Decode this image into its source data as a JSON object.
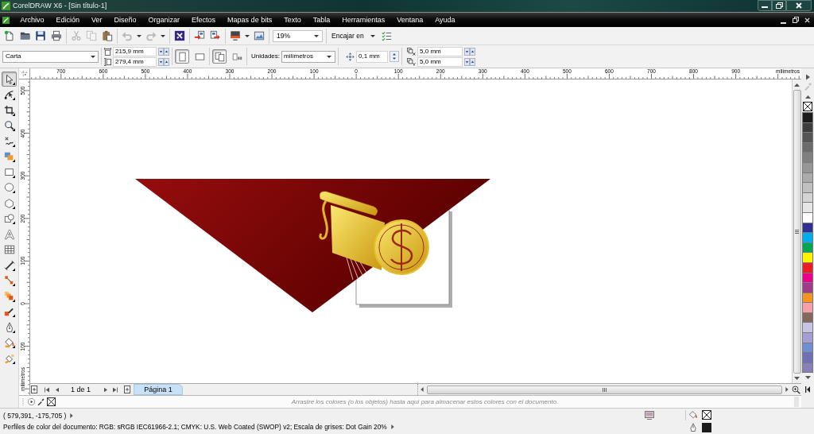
{
  "title_bar": {
    "title": "CorelDRAW X6 - [Sin título-1]"
  },
  "menu_bar": {
    "items": [
      "Archivo",
      "Edición",
      "Ver",
      "Diseño",
      "Organizar",
      "Efectos",
      "Mapas de bits",
      "Texto",
      "Tabla",
      "Herramientas",
      "Ventana",
      "Ayuda"
    ]
  },
  "standard_toolbar": {
    "groups": [
      [
        {
          "kind": "new",
          "disabled": false
        },
        {
          "kind": "open",
          "disabled": false
        },
        {
          "kind": "save",
          "disabled": false
        },
        {
          "kind": "print",
          "disabled": false
        }
      ],
      [
        {
          "kind": "cut",
          "disabled": true
        },
        {
          "kind": "copy",
          "disabled": true
        },
        {
          "kind": "paste",
          "disabled": false
        }
      ],
      [
        {
          "kind": "undo",
          "disabled": true,
          "dropdown": true
        },
        {
          "kind": "redo",
          "disabled": true,
          "dropdown": true
        }
      ],
      [
        {
          "kind": "connect",
          "disabled": false
        }
      ],
      [
        {
          "kind": "import",
          "disabled": false
        },
        {
          "kind": "export",
          "disabled": false
        }
      ],
      [
        {
          "kind": "launcher",
          "disabled": false,
          "dropdown": true
        },
        {
          "kind": "welcome",
          "disabled": false
        }
      ]
    ],
    "zoom": "19%",
    "snap": "Encajar en"
  },
  "property_bar": {
    "paper_size": "Carta",
    "page_width": "215,9 mm",
    "page_height": "279,4 mm",
    "orientation": [
      {
        "kind": "portrait",
        "selected": true
      },
      {
        "kind": "landscape",
        "selected": false
      }
    ],
    "page_scope": [
      {
        "kind": "all_pages",
        "selected": true
      },
      {
        "kind": "current_page",
        "selected": false
      }
    ],
    "units_label": "Unidades:",
    "units": "milímetros",
    "nudge": "0,1 mm",
    "duplicate_x": "5,0 mm",
    "duplicate_y": "5,0 mm"
  },
  "toolbox": {
    "tools": [
      {
        "kind": "pick",
        "selected": true
      },
      {
        "kind": "shape",
        "selected": false
      },
      {
        "kind": "crop",
        "selected": false
      },
      {
        "kind": "zoom",
        "selected": false
      },
      {
        "kind": "freehand",
        "selected": false
      },
      {
        "kind": "smart_fill",
        "selected": false
      },
      {
        "kind": "rectangle",
        "selected": false
      },
      {
        "kind": "ellipse",
        "selected": false
      },
      {
        "kind": "polygon",
        "selected": false
      },
      {
        "kind": "basic_shapes",
        "selected": false
      },
      {
        "kind": "text",
        "selected": false
      },
      {
        "kind": "table",
        "selected": false
      },
      {
        "kind": "dimension",
        "selected": false
      },
      {
        "kind": "connector",
        "selected": false
      },
      {
        "kind": "blend",
        "selected": false
      },
      {
        "kind": "eyedropper",
        "selected": false
      },
      {
        "kind": "outline",
        "selected": false
      },
      {
        "kind": "fill",
        "selected": false
      },
      {
        "kind": "interactive_fill",
        "selected": false
      }
    ]
  },
  "horizontal_ruler": {
    "labels": [
      "700",
      "600",
      "500",
      "400",
      "300",
      "200",
      "100",
      "0",
      "100",
      "200",
      "300",
      "400",
      "500",
      "600",
      "700",
      "800",
      "900"
    ],
    "unit": "milímetros"
  },
  "vertical_ruler": {
    "labels": [
      "500",
      "400",
      "300",
      "200",
      "100",
      "0",
      "100"
    ],
    "unit": "milímetros"
  },
  "page_navigator": {
    "counter": "1 de 1",
    "tabs": [
      {
        "label": "Página 1",
        "selected": true
      }
    ]
  },
  "document_palette": {
    "hint": "Arrastre los colores (o los objetos) hasta aquí para almacenar estos colores con el documento."
  },
  "color_palette": {
    "swatches": [
      {
        "color": "#1c1c1c"
      },
      {
        "color": "#3d3d3d"
      },
      {
        "color": "#555555"
      },
      {
        "color": "#6b6b6b"
      },
      {
        "color": "#808080"
      },
      {
        "color": "#969696"
      },
      {
        "color": "#ababab"
      },
      {
        "color": "#c0c0c0"
      },
      {
        "color": "#d4d4d4"
      },
      {
        "color": "#e6e6e6"
      },
      {
        "color": "#ffffff"
      },
      {
        "color": "#2e3192"
      },
      {
        "color": "#00aeef"
      },
      {
        "color": "#00a651"
      },
      {
        "color": "#fff200"
      },
      {
        "color": "#ed1c24"
      },
      {
        "color": "#ec008c"
      },
      {
        "color": "#9e3c8c"
      },
      {
        "color": "#f7941d"
      },
      {
        "color": "#f5a0a8"
      },
      {
        "color": "#806a5e"
      },
      {
        "color": "#c8c4e6"
      },
      {
        "color": "#a59ed3"
      },
      {
        "color": "#6f8fd1"
      },
      {
        "color": "#6f6fb8"
      },
      {
        "color": "#8a80b8"
      }
    ]
  },
  "status_bar": {
    "coordinates": "( 579,391, -175,705 )",
    "color_profiles": "Perfiles de color del documento: RGB: sRGB IEC61966-2.1; CMYK: U.S. Web Coated (SWOP) v2; Escala de grises: Dot Gain 20%",
    "fill": {
      "kind": "none"
    },
    "outline": {
      "kind": "solid",
      "color": "#1c1c1c"
    }
  }
}
